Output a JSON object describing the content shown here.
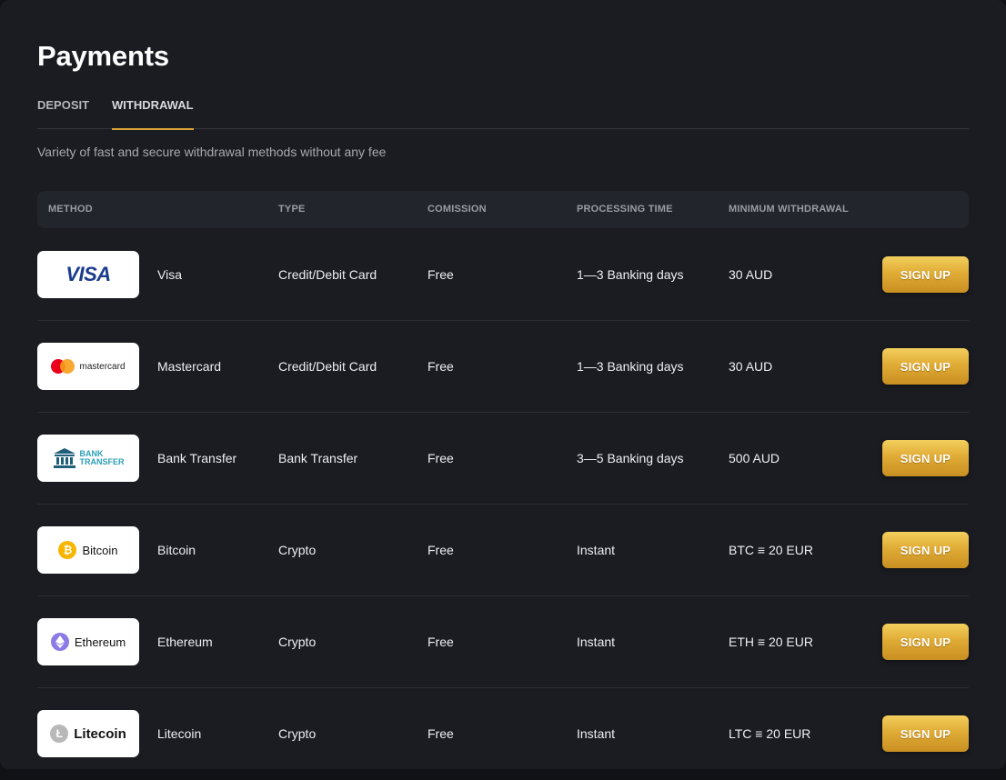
{
  "page": {
    "title": "Payments",
    "subtitle": "Variety of fast and secure withdrawal methods without any fee"
  },
  "tabs": [
    {
      "label": "DEPOSIT",
      "active": false
    },
    {
      "label": "WITHDRAWAL",
      "active": true
    }
  ],
  "table": {
    "headers": [
      "METHOD",
      "TYPE",
      "COMISSION",
      "PROCESSING TIME",
      "MINIMUM WITHDRAWAL"
    ],
    "rows": [
      {
        "logo": "VISA",
        "icon": "visa-logo-icon",
        "method": "Visa",
        "type": "Credit/Debit Card",
        "commission": "Free",
        "processing": "1—3 Banking days",
        "minimum": "30 AUD",
        "button": "SIGN UP"
      },
      {
        "logo": "mastercard",
        "icon": "mastercard-logo-icon",
        "method": "Mastercard",
        "type": "Credit/Debit Card",
        "commission": "Free",
        "processing": "1—3 Banking days",
        "minimum": "30 AUD",
        "button": "SIGN UP"
      },
      {
        "logo_line1": "BANK",
        "logo_line2": "TRANSFER",
        "icon": "bank-building-icon",
        "method": "Bank Transfer",
        "type": "Bank Transfer",
        "commission": "Free",
        "processing": "3—5 Banking days",
        "minimum": "500 AUD",
        "button": "SIGN UP"
      },
      {
        "logo": "Bitcoin",
        "icon": "bitcoin-icon",
        "method": "Bitcoin",
        "type": "Crypto",
        "commission": "Free",
        "processing": "Instant",
        "minimum": "BTC ≡ 20 EUR",
        "button": "SIGN UP"
      },
      {
        "logo": "Ethereum",
        "icon": "ethereum-icon",
        "method": "Ethereum",
        "type": "Crypto",
        "commission": "Free",
        "processing": "Instant",
        "minimum": "ETH ≡ 20 EUR",
        "button": "SIGN UP"
      },
      {
        "logo": "Litecoin",
        "icon": "litecoin-icon",
        "method": "Litecoin",
        "type": "Crypto",
        "commission": "Free",
        "processing": "Instant",
        "minimum": "LTC ≡ 20 EUR",
        "button": "SIGN UP"
      }
    ]
  },
  "colors": {
    "background": "#1b1c21",
    "header_row": "#23252c",
    "accent": "#d9a436",
    "bitcoin": "#f7b500",
    "ethereum": "#8c7ae6",
    "litecoin": "#b8b8b8"
  }
}
